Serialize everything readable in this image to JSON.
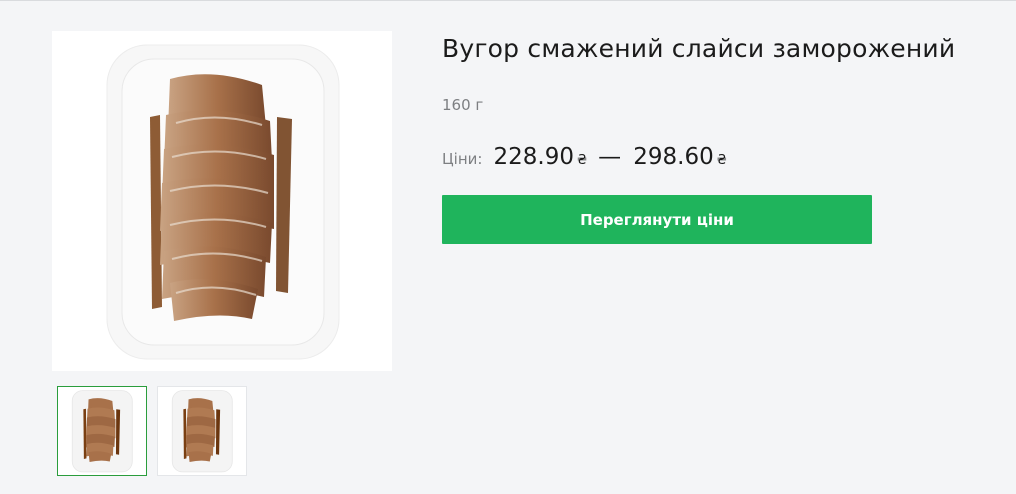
{
  "product": {
    "title": "Вугор смажений слайси заморожений",
    "weight": "160 г",
    "prices_label": "Ціни:",
    "price_min": "228.90",
    "price_max": "298.60",
    "currency": "₴",
    "separator": "—",
    "view_prices_button": "Переглянути ціни"
  },
  "colors": {
    "accent": "#1fb45c",
    "active_thumb_border": "#2a9d3c",
    "background": "#f4f5f7"
  },
  "gallery": {
    "images": [
      "eel-tray-photo",
      "eel-tray-photo"
    ],
    "active_thumbnail": 1
  }
}
